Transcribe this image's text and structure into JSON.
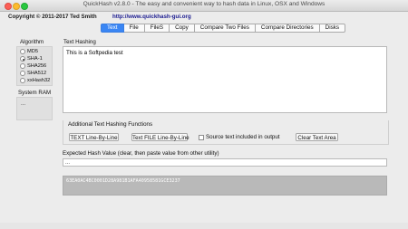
{
  "window": {
    "title": "QuickHash v2.8.0 - The easy and convenient way to hash data in Linux, OSX and Windows"
  },
  "header": {
    "copyright": "Copyright © 2011-2017  Ted Smith",
    "url": "http://www.quickhash-gui.org"
  },
  "tabs": [
    {
      "label": "Text",
      "active": true
    },
    {
      "label": "File",
      "active": false
    },
    {
      "label": "FileS",
      "active": false
    },
    {
      "label": "Copy",
      "active": false
    },
    {
      "label": "Compare Two Files",
      "active": false
    },
    {
      "label": "Compare Directories",
      "active": false
    },
    {
      "label": "Disks",
      "active": false
    }
  ],
  "algorithm": {
    "label": "Algorithm",
    "options": [
      {
        "label": "MD5",
        "checked": false
      },
      {
        "label": "SHA-1",
        "checked": true
      },
      {
        "label": "SHA256",
        "checked": false
      },
      {
        "label": "SHA512",
        "checked": false
      },
      {
        "label": "xxHash32",
        "checked": false
      }
    ]
  },
  "system_ram": {
    "label": "System RAM",
    "value": "..."
  },
  "text_hashing": {
    "label": "Text Hashing",
    "input_text": "This is a Softpedia test"
  },
  "functions": {
    "title": "Additional Text Hashing Functions",
    "text_line_button": "TEXT Line-By-Line",
    "text_file_button": "Text FILE Line-By-Line",
    "source_checkbox_label": "Source text included in output",
    "source_checkbox_checked": false,
    "clear_button": "Clear Text Area"
  },
  "expected": {
    "label": "Expected Hash Value (clear, then paste value from other utility)",
    "value": "..."
  },
  "result": {
    "hash": "63EA0AC4BC0001D28A981B1AFA40958581GCE3237"
  },
  "colors": {
    "accent": "#3a86f4",
    "hash_background": "#b9b9b9"
  }
}
